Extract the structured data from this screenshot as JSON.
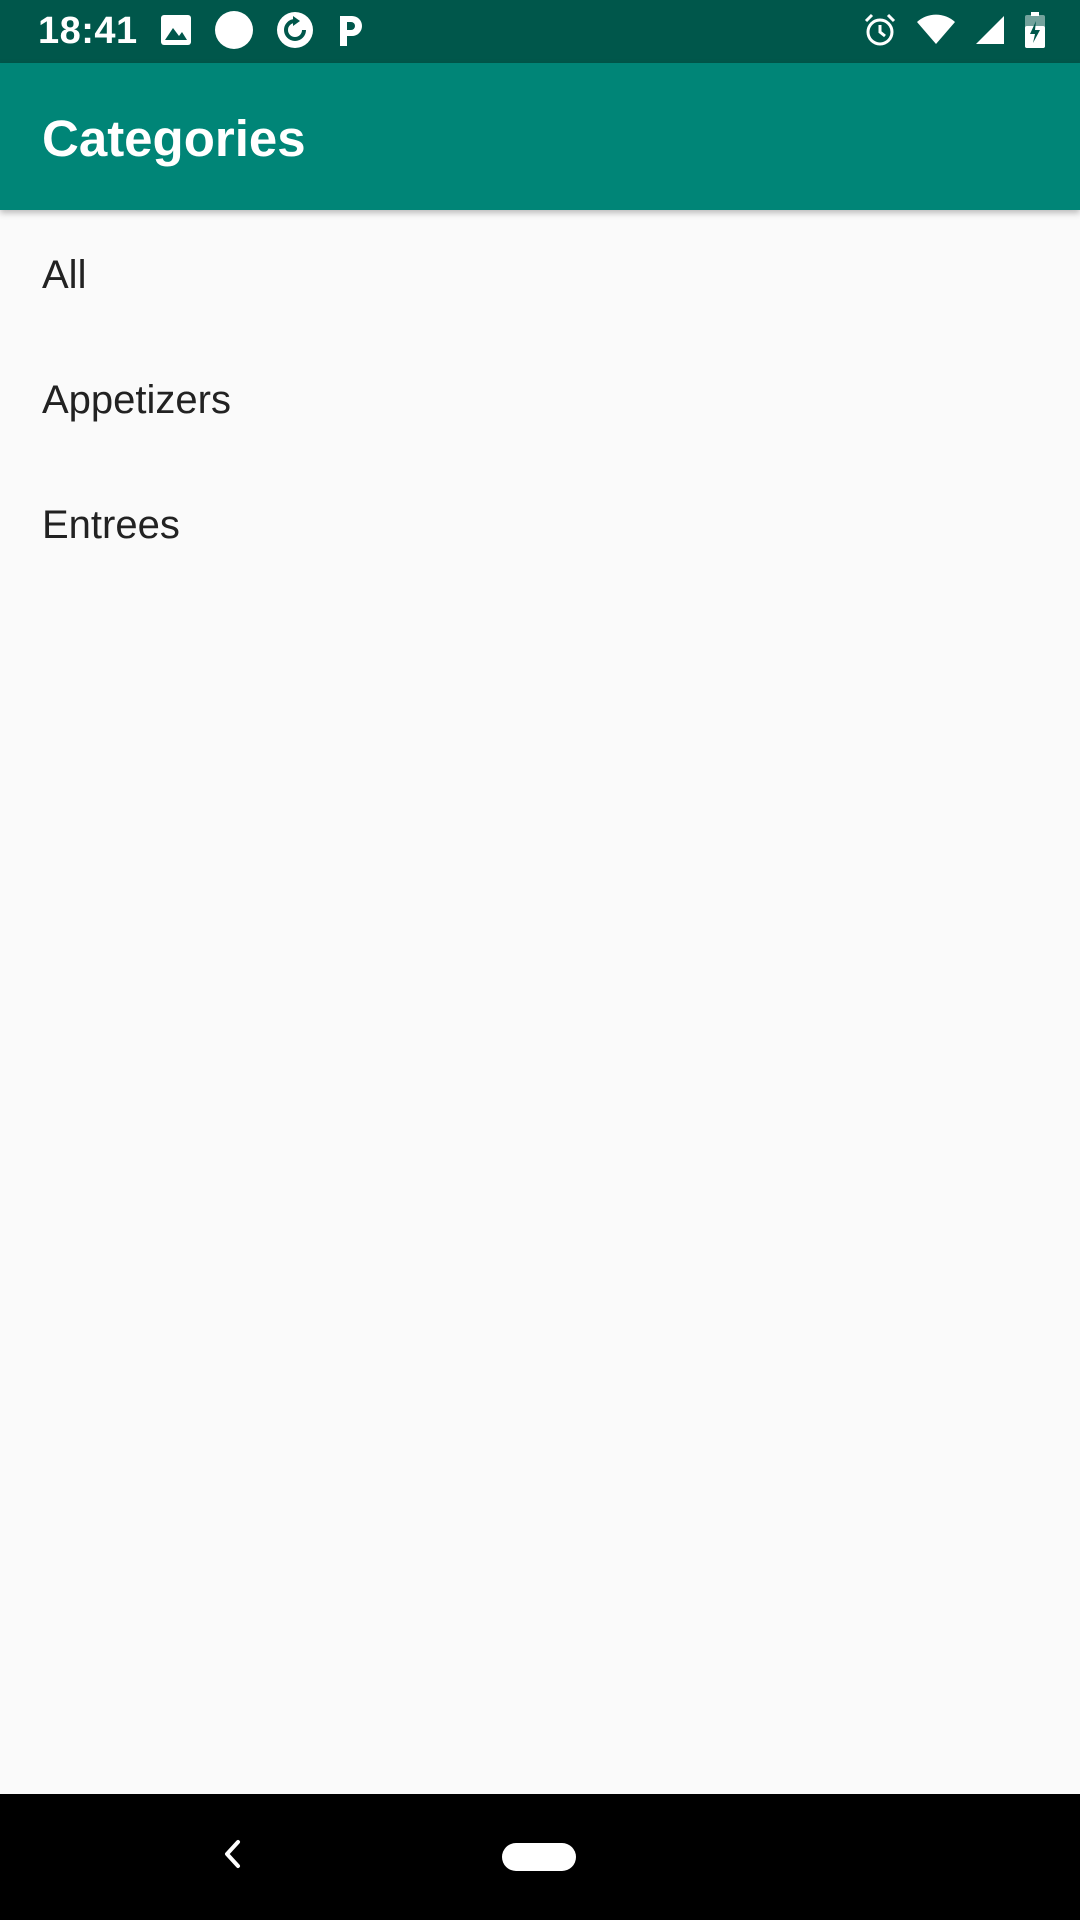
{
  "status_bar": {
    "time": "18:41",
    "left_icons": [
      "image-icon",
      "circle-icon",
      "sync-icon",
      "parking-icon"
    ],
    "right_icons": [
      "alarm-icon",
      "wifi-icon",
      "cellular-signal-icon",
      "battery-charging-icon"
    ]
  },
  "app_bar": {
    "title": "Categories",
    "color": "#008577",
    "status_color": "#00574b"
  },
  "categories": {
    "items": [
      {
        "label": "All"
      },
      {
        "label": "Appetizers"
      },
      {
        "label": "Entrees"
      }
    ]
  },
  "nav_bar": {
    "icons": [
      "back-icon",
      "home-icon"
    ]
  }
}
